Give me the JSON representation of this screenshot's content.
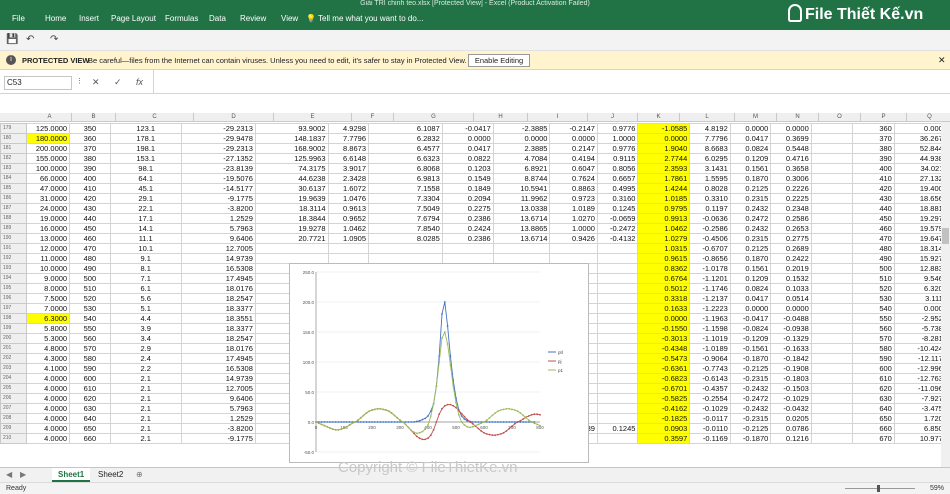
{
  "titlebar": "Giải TRI chinh teo.xlsx [Protected View] - Excel (Product Activation Failed)",
  "menu": {
    "file": "File",
    "home": "Home",
    "insert": "Insert",
    "page_layout": "Page Layout",
    "formulas": "Formulas",
    "data": "Data",
    "review": "Review",
    "view": "View",
    "tell": "Tell me what you want to do..."
  },
  "logo": "File Thiết Kế.vn",
  "protected": {
    "label": "PROTECTED VIEW",
    "message": "Be careful—files from the Internet can contain viruses. Unless you need to edit, it's safer to stay in Protected View.",
    "button": "Enable Editing"
  },
  "namebox": "C53",
  "fx": "fx",
  "columns": [
    "A",
    "B",
    "C",
    "D",
    "E",
    "F",
    "G",
    "H",
    "I",
    "J",
    "K",
    "L",
    "M",
    "N",
    "O",
    "P",
    "Q",
    "R"
  ],
  "rows": [
    [
      "179",
      "125.0000",
      "350",
      "123.1",
      "-29.2313",
      "93.9002",
      "4.9298",
      "6.1087",
      "-0.0417",
      "-2.3885",
      "-0.2147",
      "0.9776",
      "-1.0585",
      "4.8192",
      "0.0000",
      "0.0000",
      "",
      "360",
      "0.0000"
    ],
    [
      "180",
      "180.0000",
      "360",
      "178.1",
      "-29.9478",
      "148.1837",
      "7.7796",
      "6.2832",
      "0.0000",
      "0.0000",
      "0.0000",
      "1.0000",
      "0.0000",
      "7.7796",
      "0.0417",
      "0.3699",
      "",
      "370",
      "36.2673"
    ],
    [
      "181",
      "200.0000",
      "370",
      "198.1",
      "-29.2313",
      "168.9002",
      "8.8673",
      "6.4577",
      "0.0417",
      "2.3885",
      "0.2147",
      "0.9776",
      "1.9040",
      "8.6683",
      "0.0824",
      "0.5448",
      "",
      "380",
      "52.8448"
    ],
    [
      "182",
      "155.0000",
      "380",
      "153.1",
      "-27.1352",
      "125.9963",
      "6.6148",
      "6.6323",
      "0.0822",
      "4.7084",
      "0.4194",
      "0.9115",
      "2.7744",
      "6.0295",
      "0.1209",
      "0.4716",
      "",
      "390",
      "44.9383"
    ],
    [
      "183",
      "100.0000",
      "390",
      "98.1",
      "-23.8139",
      "74.3175",
      "3.9017",
      "6.8068",
      "0.1203",
      "6.8921",
      "0.6047",
      "0.8056",
      "2.3593",
      "3.1431",
      "0.1561",
      "0.3658",
      "",
      "400",
      "34.0211"
    ],
    [
      "184",
      "66.0000",
      "400",
      "64.1",
      "-19.5076",
      "44.6238",
      "2.3428",
      "6.9813",
      "0.1549",
      "8.8744",
      "0.7624",
      "0.6657",
      "1.7861",
      "1.5595",
      "0.1870",
      "0.3006",
      "",
      "410",
      "27.1320"
    ],
    [
      "185",
      "47.0000",
      "410",
      "45.1",
      "-14.5177",
      "30.6137",
      "1.6072",
      "7.1558",
      "0.1849",
      "10.5941",
      "0.8863",
      "0.4995",
      "1.4244",
      "0.8028",
      "0.2125",
      "0.2226",
      "",
      "420",
      "19.4005"
    ],
    [
      "186",
      "31.0000",
      "420",
      "29.1",
      "-9.1775",
      "19.9639",
      "1.0476",
      "7.3304",
      "0.2094",
      "11.9962",
      "0.9723",
      "0.3160",
      "1.0185",
      "0.3310",
      "0.2315",
      "0.2225",
      "",
      "430",
      "18.6569"
    ],
    [
      "187",
      "24.0000",
      "430",
      "22.1",
      "-3.8200",
      "18.3114",
      "0.9613",
      "7.5049",
      "0.2275",
      "13.0338",
      "1.0189",
      "0.1245",
      "0.9795",
      "0.1197",
      "0.2432",
      "0.2348",
      "",
      "440",
      "18.8816"
    ],
    [
      "188",
      "19.0000",
      "440",
      "17.1",
      "1.2529",
      "18.3844",
      "0.9652",
      "7.6794",
      "0.2386",
      "13.6714",
      "1.0270",
      "-0.0659",
      "0.9913",
      "-0.0636",
      "0.2472",
      "0.2586",
      "",
      "450",
      "19.2978"
    ],
    [
      "189",
      "16.0000",
      "450",
      "14.1",
      "5.7963",
      "19.9278",
      "1.0462",
      "7.8540",
      "0.2424",
      "13.8865",
      "1.0000",
      "-0.2472",
      "1.0462",
      "-0.2586",
      "0.2432",
      "0.2653",
      "",
      "460",
      "19.5791"
    ],
    [
      "190",
      "13.0000",
      "460",
      "11.1",
      "9.6406",
      "20.7721",
      "1.0905",
      "8.0285",
      "0.2386",
      "13.6714",
      "0.9426",
      "-0.4132",
      "1.0279",
      "-0.4506",
      "0.2315",
      "0.2775",
      "",
      "470",
      "19.6473"
    ],
    [
      "191",
      "12.0000",
      "470",
      "10.1",
      "12.7005",
      "",
      "",
      "",
      "",
      "",
      "",
      "",
      "1.0315",
      "-0.6707",
      "0.2125",
      "0.2689",
      "",
      "480",
      "18.3148"
    ],
    [
      "192",
      "11.0000",
      "480",
      "9.1",
      "14.9739",
      "",
      "",
      "",
      "",
      "",
      "",
      "",
      "0.9615",
      "-0.8656",
      "0.1870",
      "0.2422",
      "",
      "490",
      "15.9273"
    ],
    [
      "193",
      "10.0000",
      "490",
      "8.1",
      "16.5308",
      "",
      "",
      "",
      "",
      "",
      "",
      "",
      "0.8362",
      "-1.0178",
      "0.1561",
      "0.2019",
      "",
      "500",
      "12.8838"
    ],
    [
      "194",
      "9.0000",
      "500",
      "7.1",
      "17.4945",
      "",
      "",
      "",
      "",
      "",
      "",
      "",
      "0.6764",
      "-1.1201",
      "0.1209",
      "0.1532",
      "",
      "510",
      "9.5466"
    ],
    [
      "195",
      "8.0000",
      "510",
      "6.1",
      "18.0176",
      "",
      "",
      "",
      "",
      "",
      "",
      "",
      "0.5012",
      "-1.1746",
      "0.0824",
      "0.1033",
      "",
      "520",
      "6.3208"
    ],
    [
      "196",
      "7.5000",
      "520",
      "5.6",
      "18.2547",
      "",
      "",
      "",
      "",
      "",
      "",
      "",
      "0.3318",
      "-1.2137",
      "0.0417",
      "0.0514",
      "",
      "530",
      "3.1113"
    ],
    [
      "197",
      "7.0000",
      "530",
      "5.1",
      "18.3377",
      "",
      "",
      "",
      "",
      "",
      "",
      "",
      "0.1633",
      "-1.2223",
      "0.0000",
      "0.0000",
      "",
      "540",
      "0.0000"
    ],
    [
      "198",
      "6.3000",
      "540",
      "4.4",
      "18.3551",
      "",
      "",
      "",
      "",
      "",
      "",
      "",
      "0.0000",
      "-1.1963",
      "-0.0417",
      "-0.0488",
      "",
      "550",
      "-2.9522"
    ],
    [
      "199",
      "5.8000",
      "550",
      "3.9",
      "18.3377",
      "",
      "",
      "",
      "",
      "",
      "",
      "",
      "-0.1550",
      "-1.1598",
      "-0.0824",
      "-0.0938",
      "",
      "560",
      "-5.7387"
    ],
    [
      "200",
      "5.3000",
      "560",
      "3.4",
      "18.2547",
      "",
      "",
      "",
      "",
      "",
      "",
      "",
      "-0.3013",
      "-1.1019",
      "-0.1209",
      "-0.1329",
      "",
      "570",
      "-8.2816"
    ],
    [
      "201",
      "4.8000",
      "570",
      "2.9",
      "18.0176",
      "",
      "",
      "",
      "",
      "",
      "",
      "",
      "-0.4348",
      "-1.0189",
      "-0.1561",
      "-0.1633",
      "",
      "580",
      "-10.4248"
    ],
    [
      "202",
      "4.3000",
      "580",
      "2.4",
      "17.4945",
      "",
      "",
      "",
      "",
      "",
      "",
      "",
      "-0.5473",
      "-0.9064",
      "-0.1870",
      "-0.1842",
      "",
      "590",
      "-12.1170"
    ],
    [
      "203",
      "4.1000",
      "590",
      "2.2",
      "16.5308",
      "",
      "",
      "",
      "",
      "",
      "",
      "",
      "-0.6361",
      "-0.7743",
      "-0.2125",
      "-0.1908",
      "",
      "600",
      "-12.9963"
    ],
    [
      "204",
      "4.0000",
      "600",
      "2.1",
      "14.9739",
      "",
      "",
      "",
      "",
      "",
      "",
      "",
      "-0.6823",
      "-0.6143",
      "-0.2315",
      "-0.1803",
      "",
      "610",
      "-12.7632"
    ],
    [
      "205",
      "4.0000",
      "610",
      "2.1",
      "12.7005",
      "",
      "",
      "",
      "",
      "",
      "",
      "",
      "-0.6701",
      "-0.4357",
      "-0.2432",
      "-0.1503",
      "",
      "620",
      "-11.0960"
    ],
    [
      "206",
      "4.0000",
      "620",
      "2.1",
      "9.6406",
      "",
      "",
      "",
      "",
      "",
      "",
      "",
      "-0.5825",
      "-0.2554",
      "-0.2472",
      "-0.1029",
      "",
      "630",
      "-7.9278"
    ],
    [
      "207",
      "4.0000",
      "630",
      "2.1",
      "5.7963",
      "",
      "",
      "",
      "",
      "",
      "",
      "",
      "-0.4162",
      "-0.1029",
      "-0.2432",
      "-0.0432",
      "",
      "640",
      "-3.4759"
    ],
    [
      "208",
      "4.0000",
      "640",
      "2.1",
      "1.2529",
      "",
      "",
      "",
      "",
      "",
      "",
      "",
      "-0.1825",
      "-0.0117",
      "-0.2315",
      "0.0205",
      "",
      "650",
      "1.7204"
    ],
    [
      "209",
      "4.0000",
      "650",
      "2.1",
      "-3.8200",
      "-1.6886",
      "-0.0887",
      "11.3446",
      "-0.2275",
      "-13.0338",
      "-1.0189",
      "0.1245",
      "0.0903",
      "-0.0110",
      "-0.2125",
      "0.0786",
      "",
      "660",
      "6.8507"
    ],
    [
      "210",
      "4.0000",
      "660",
      "2.1",
      "-9.1775",
      "7.0461",
      "0.3699",
      "",
      "",
      "",
      "",
      "",
      "0.3597",
      "-0.1169",
      "-0.1870",
      "0.1216",
      "",
      "670",
      "10.9776"
    ]
  ],
  "chart_data": {
    "type": "line",
    "series": [
      {
        "name": "ptl",
        "color": "#4472c4",
        "values": [
          0,
          0,
          0,
          0,
          0,
          0,
          0,
          0,
          0,
          0,
          0,
          0,
          0,
          0,
          0,
          0,
          0,
          0,
          0,
          0,
          0,
          0,
          0,
          0,
          0,
          0,
          0,
          0,
          0,
          0,
          0,
          0,
          0,
          0,
          0,
          0,
          1,
          2,
          4,
          6,
          10,
          18,
          30,
          60,
          110,
          180,
          200,
          160,
          110,
          70,
          40,
          20,
          10,
          5,
          2,
          1,
          0,
          0,
          0,
          0,
          0,
          0,
          0,
          0,
          0,
          0,
          0,
          0,
          0,
          0,
          0,
          0,
          0,
          0,
          0,
          0,
          0,
          0,
          0
        ]
      },
      {
        "name": "pj",
        "color": "#c0504d",
        "values": [
          0,
          -2,
          -4,
          -6,
          -8,
          -10,
          -12,
          -13,
          -13,
          -12,
          -10,
          -8,
          -5,
          -2,
          0,
          3,
          7,
          11,
          15,
          18,
          20,
          21,
          22,
          22,
          21,
          20,
          18,
          15,
          11,
          7,
          3,
          0,
          -4,
          -9,
          -14,
          -19,
          -24,
          -27,
          -29,
          -29,
          -27,
          -22,
          -13,
          0,
          13,
          22,
          27,
          29,
          29,
          27,
          24,
          19,
          14,
          9,
          4,
          0,
          -3,
          -7,
          -11,
          -15,
          -18,
          -20,
          -21,
          -22,
          -22,
          -21,
          -20,
          -18,
          -15,
          -11,
          -7,
          -3,
          0,
          2,
          5,
          8,
          10,
          12,
          13,
          13,
          12
        ]
      },
      {
        "name": "p1",
        "color": "#9bbb59",
        "values": [
          0,
          -2,
          -4,
          -6,
          -8,
          -10,
          -12,
          -13,
          -13,
          -12,
          -10,
          -8,
          -5,
          -2,
          0,
          3,
          7,
          11,
          15,
          18,
          20,
          21,
          22,
          22,
          21,
          20,
          18,
          15,
          11,
          7,
          3,
          0,
          -4,
          -9,
          -14,
          -17,
          -19,
          -18,
          -16,
          -12,
          -5,
          10,
          30,
          60,
          100,
          140,
          150,
          130,
          95,
          60,
          32,
          12,
          0,
          -5,
          -8,
          -9,
          -8,
          -6,
          -4,
          -2,
          0,
          3,
          7,
          11,
          15,
          18,
          20,
          21,
          22,
          22,
          21,
          20,
          18,
          15,
          11,
          7,
          3,
          0,
          -2,
          -4,
          -6
        ]
      }
    ],
    "x_start": 0,
    "x_step": 10,
    "xlim": [
      0,
      800
    ],
    "ylim": [
      -50,
      250
    ],
    "xticks": [
      "0",
      "100",
      "200",
      "300",
      "400",
      "500",
      "600",
      "700",
      "800"
    ],
    "yticks": [
      "250.0",
      "200.0",
      "150.0",
      "100.0",
      "50.0",
      "0.0",
      "-50.0"
    ]
  },
  "sheets": [
    "Sheet1",
    "Sheet2"
  ],
  "status": {
    "ready": "Ready",
    "zoom": "59%"
  },
  "watermark": "Copyright © FileThietKe.vn"
}
